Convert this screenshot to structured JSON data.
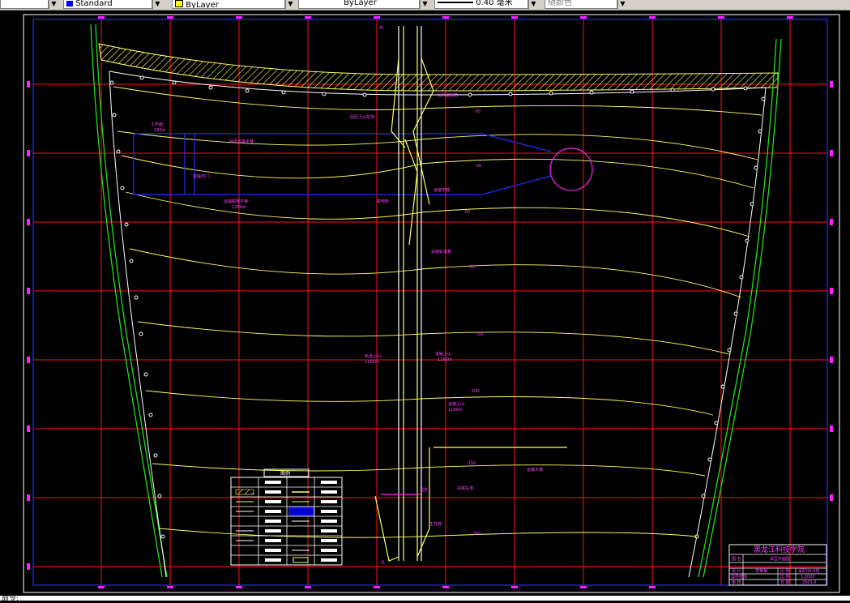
{
  "toolbar": {
    "text_style": "Standard",
    "color": "ByLayer",
    "linetype": "ByLayer",
    "lineweight": "0.40 毫米",
    "plot_style": "随颜色",
    "color_swatch": "#ffff00"
  },
  "drawing": {
    "section_marker_top": "A",
    "section_marker_bottom": "A",
    "contours": [
      "-50",
      "-30",
      "-50",
      "-20",
      "-50",
      "-100",
      "-150",
      "-200"
    ],
    "labels": {
      "top_return_lane": "回风运输巷",
      "yard_label": "回风上山车场",
      "workface_top_tag": "工作面",
      "workface_top_len": "180m",
      "upper_lane": "回风运输平巷",
      "lower_lane": "运输顺槽平巷",
      "lower_lane_len": "1280m",
      "substation": "变电所",
      "mid_label": "运输平巷",
      "inclined_label": "运输轨道巷",
      "uphill_left": "轨道上山",
      "uphill_left_len": "1160m",
      "uphill_right": "运输上山",
      "uphill_right_len": "1160m",
      "inclined_main": "运输上山",
      "inclined_main_len": "1160m",
      "bottom_right": "运输大巷",
      "yard_bottom": "井底车场",
      "shaft_bottom": "副井",
      "pump": "主井底",
      "main_shaft_label": "运输石门"
    }
  },
  "legend": {
    "title": "图例",
    "rows": 9
  },
  "title_block": {
    "school": "黑龙江科技学院",
    "drawing_name": "采区平面图",
    "r1c1": "图  名",
    "r2c1": "设  计",
    "r2c2": "李某某",
    "r2c3": "比  例",
    "r2c4": "采矿00-5班",
    "r3c1": "指导老师",
    "r3c3": "比  例",
    "r3c4": "1:2000",
    "r4c1": "审  核",
    "r4c3": "日  期",
    "r4c4": "2001.6"
  },
  "status": {
    "command": "命令:"
  }
}
